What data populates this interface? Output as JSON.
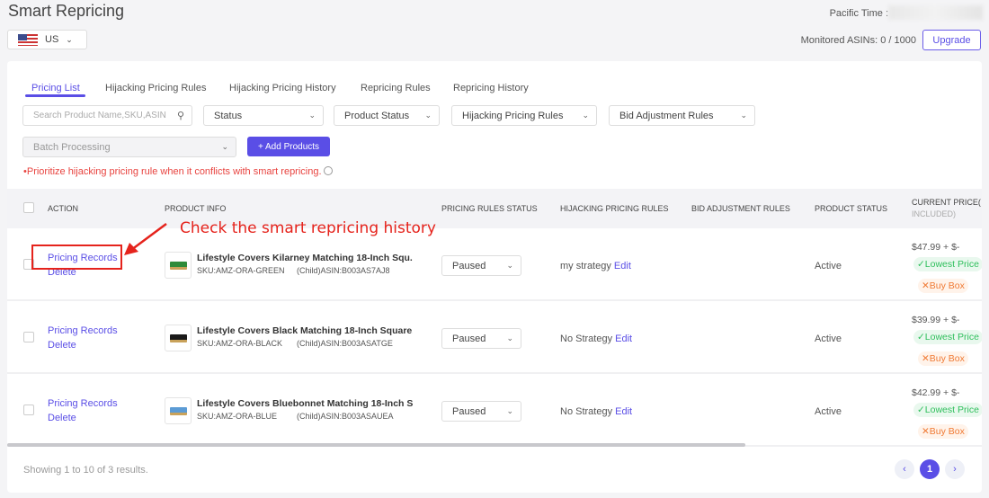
{
  "header": {
    "title": "Smart Repricing",
    "country": "US",
    "pacific_time_label": "Pacific Time :",
    "monitored": "Monitored ASINs: 0 / 1000",
    "upgrade": "Upgrade"
  },
  "tabs": [
    "Pricing List",
    "Hijacking Pricing Rules",
    "Hijacking Pricing History",
    "Repricing Rules",
    "Repricing History"
  ],
  "filters": {
    "search_placeholder": "Search Product Name,SKU,ASIN",
    "status": "Status",
    "product_status": "Product Status",
    "hijacking": "Hijacking Pricing Rules",
    "bid": "Bid Adjustment Rules",
    "batch": "Batch Processing",
    "add": "+ Add Products"
  },
  "note": "•Prioritize hijacking pricing rule when it conflicts with smart repricing.",
  "columns": [
    "ACTION",
    "PRODUCT INFO",
    "PRICING RULES STATUS",
    "HIJACKING PRICING RULES",
    "BID ADJUSTMENT RULES",
    "PRODUCT STATUS",
    "CURRENT PRICE(",
    "INCLUDED)"
  ],
  "rows": [
    {
      "records": "Pricing Records",
      "delete": "Delete",
      "name": "Lifestyle Covers Kilarney Matching 18-Inch Squ...",
      "sku": "SKU:AMZ-ORA-GREEN",
      "asin": "(Child)ASIN:B003AS7AJ8",
      "status": "Paused",
      "strategy": "my strategy",
      "edit": "Edit",
      "product_status": "Active",
      "price": "$47.99 + $-",
      "lowest": "✓Lowest Price",
      "buybox": "✕Buy Box",
      "color": "#2e8b3a"
    },
    {
      "records": "Pricing Records",
      "delete": "Delete",
      "name": "Lifestyle Covers Black Matching 18-Inch Square...",
      "sku": "SKU:AMZ-ORA-BLACK",
      "asin": "(Child)ASIN:B003ASATGE",
      "status": "Paused",
      "strategy": "No Strategy",
      "edit": "Edit",
      "product_status": "Active",
      "price": "$39.99 + $-",
      "lowest": "✓Lowest Price",
      "buybox": "✕Buy Box",
      "color": "#1a1a1a"
    },
    {
      "records": "Pricing Records",
      "delete": "Delete",
      "name": "Lifestyle Covers Bluebonnet Matching 18-Inch S...",
      "sku": "SKU:AMZ-ORA-BLUE",
      "asin": "(Child)ASIN:B003ASAUEA",
      "status": "Paused",
      "strategy": "No Strategy",
      "edit": "Edit",
      "product_status": "Active",
      "price": "$42.99 + $-",
      "lowest": "✓Lowest Price",
      "buybox": "✕Buy Box",
      "color": "#5b9bd5"
    }
  ],
  "footer": {
    "showing": "Showing 1 to 10 of 3 results.",
    "page": "1",
    "prev": "‹",
    "next": "›"
  },
  "annotation": "Check the smart repricing history"
}
